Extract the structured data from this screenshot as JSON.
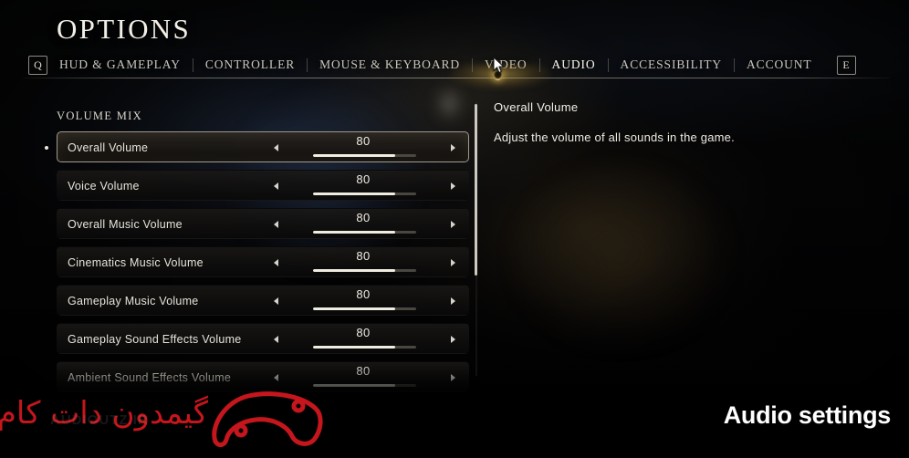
{
  "header": {
    "title": "OPTIONS",
    "prev_key": "Q",
    "next_key": "E",
    "tabs": [
      {
        "label": "HUD & GAMEPLAY",
        "active": false
      },
      {
        "label": "CONTROLLER",
        "active": false
      },
      {
        "label": "MOUSE & KEYBOARD",
        "active": false
      },
      {
        "label": "VIDEO",
        "active": false
      },
      {
        "label": "AUDIO",
        "active": true
      },
      {
        "label": "ACCESSIBILITY",
        "active": false
      },
      {
        "label": "ACCOUNT",
        "active": false
      }
    ]
  },
  "settings": {
    "section_label": "VOLUME MIX",
    "decrease_icon": "triangle-left-icon",
    "increase_icon": "triangle-right-icon",
    "rows": [
      {
        "label": "Overall Volume",
        "value": "80",
        "percent": 80,
        "selected": true
      },
      {
        "label": "Voice Volume",
        "value": "80",
        "percent": 80,
        "selected": false
      },
      {
        "label": "Overall Music Volume",
        "value": "80",
        "percent": 80,
        "selected": false
      },
      {
        "label": "Cinematics Music Volume",
        "value": "80",
        "percent": 80,
        "selected": false
      },
      {
        "label": "Gameplay Music Volume",
        "value": "80",
        "percent": 80,
        "selected": false
      },
      {
        "label": "Gameplay Sound Effects Volume",
        "value": "80",
        "percent": 80,
        "selected": false
      },
      {
        "label": "Ambient Sound Effects Volume",
        "value": "80",
        "percent": 80,
        "selected": false
      }
    ]
  },
  "description": {
    "title": "Overall Volume",
    "body": "Adjust the volume of all sounds in the game."
  },
  "overlays": {
    "watermark_text": "گیمدون دات کام",
    "watermark_ghost": "AUDIOUTZ.IR",
    "watermark_logo": "gamepad-outline-icon",
    "caption": "Audio settings",
    "cursor": "mouse-pointer-icon"
  },
  "colors": {
    "accent_gold": "#e0c074",
    "slider_fill": "#efece0",
    "slider_track": "#4a4741",
    "text_primary": "#f2efe6",
    "watermark_red": "#c4161c"
  }
}
